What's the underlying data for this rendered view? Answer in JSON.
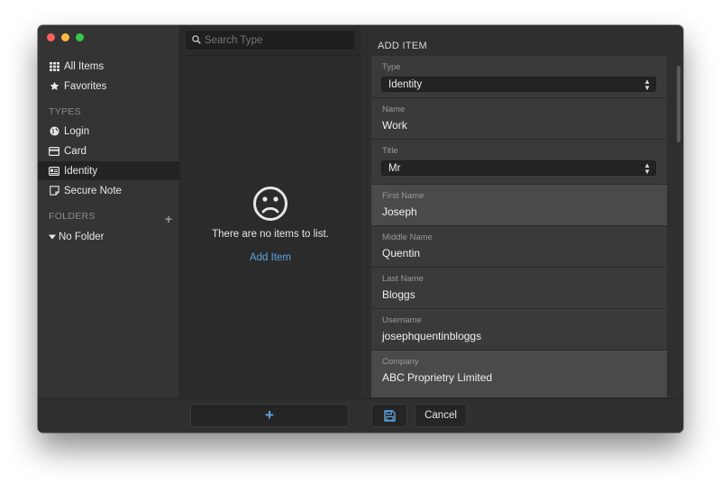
{
  "sidebar": {
    "all_items": "All Items",
    "favorites": "Favorites",
    "types_heading": "TYPES",
    "types": [
      {
        "label": "Login",
        "icon": "globe-icon"
      },
      {
        "label": "Card",
        "icon": "credit-card-icon"
      },
      {
        "label": "Identity",
        "icon": "id-card-icon"
      },
      {
        "label": "Secure Note",
        "icon": "note-icon"
      }
    ],
    "folders_heading": "FOLDERS",
    "folder_add": "+",
    "no_folder": "No Folder"
  },
  "list": {
    "search_placeholder": "Search Type",
    "empty_message": "There are no items to list.",
    "add_item_link": "Add Item",
    "add_button": "+"
  },
  "form": {
    "title": "ADD ITEM",
    "fields": [
      {
        "label": "Type",
        "value": "Identity"
      },
      {
        "label": "Name",
        "value": "Work"
      },
      {
        "label": "Title",
        "value": "Mr"
      },
      {
        "label": "First Name",
        "value": "Joseph"
      },
      {
        "label": "Middle Name",
        "value": "Quentin"
      },
      {
        "label": "Last Name",
        "value": "Bloggs"
      },
      {
        "label": "Username",
        "value": "josephquentinbloggs"
      },
      {
        "label": "Company",
        "value": "ABC Proprietry Limited"
      }
    ],
    "cancel": "Cancel"
  },
  "colors": {
    "accent": "#5aa4e2",
    "sidebar_bg": "#343434",
    "active_row": "#232323"
  }
}
